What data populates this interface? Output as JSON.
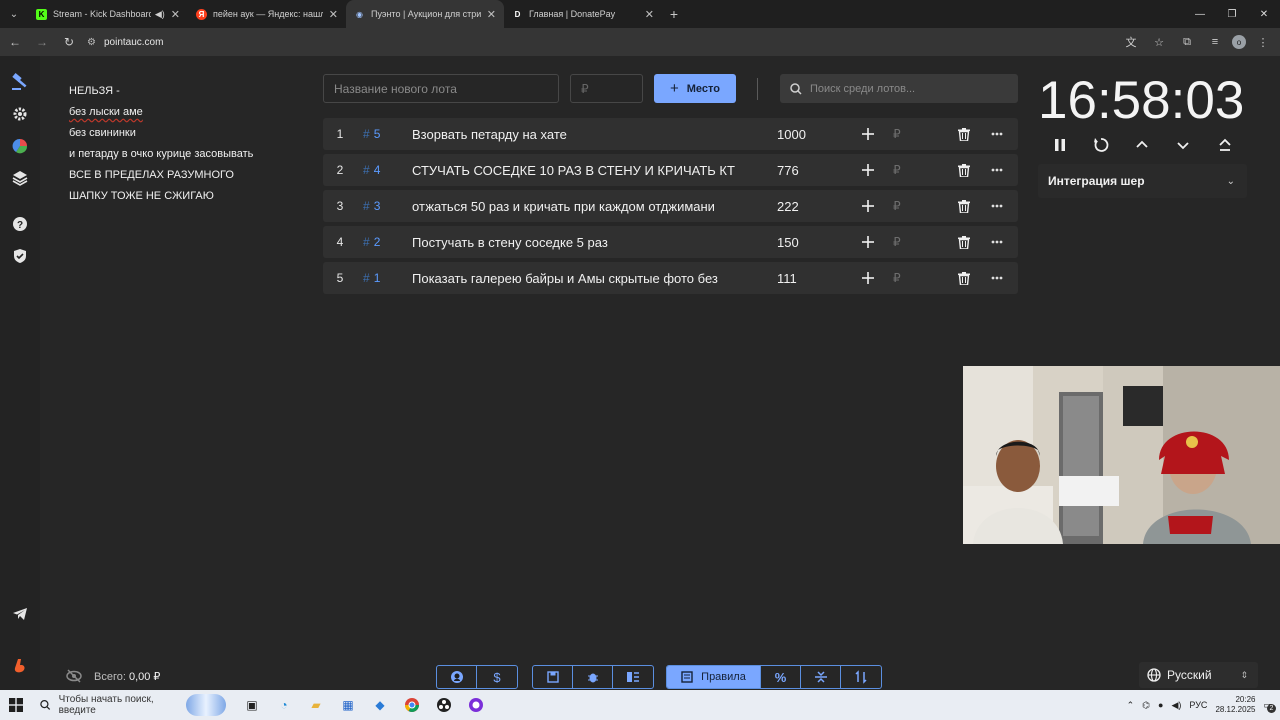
{
  "browser": {
    "tabs": [
      {
        "title": "Stream - Kick Dashboard",
        "favicon": "K",
        "favicon_color": "#53fc18",
        "has_audio": true
      },
      {
        "title": "пейен аук — Яндекс: нашлось",
        "favicon": "Я",
        "favicon_color": "#fc3f1d"
      },
      {
        "title": "Пуэнто | Аукцион для стримеров",
        "favicon": "◉",
        "favicon_color": "#a0c4ff"
      },
      {
        "title": "Главная | DonatePay",
        "favicon": "D",
        "favicon_color": "#2b2b2b"
      }
    ],
    "url": "pointauc.com",
    "profile_initial": "o"
  },
  "rules": {
    "lines": [
      "НЕЛЬЗЯ -",
      "без лыски аме",
      "без свининки",
      "и петарду в очко курице засовывать",
      "ВСЕ В ПРЕДЕЛАХ РАЗУМНОГО",
      "ШАПКУ ТОЖЕ НЕ СЖИГАЮ"
    ]
  },
  "controls": {
    "new_lot_placeholder": "Название нового лота",
    "price_placeholder": "₽",
    "place_button": "Место",
    "search_placeholder": "Поиск среди лотов..."
  },
  "lots": [
    {
      "rank": "1",
      "id": "5",
      "name": "Взорвать петарду на хате",
      "amount": "1000"
    },
    {
      "rank": "2",
      "id": "4",
      "name": "СТУЧАТЬ СОСЕДКЕ 10 РАЗ В СТЕНУ И КРИЧАТЬ КТ",
      "amount": "776"
    },
    {
      "rank": "3",
      "id": "3",
      "name": "отжаться 50 раз и кричать при каждом отджимани",
      "amount": "222"
    },
    {
      "rank": "4",
      "id": "2",
      "name": "Постучать в стену соседке 5 раз",
      "amount": "150"
    },
    {
      "rank": "5",
      "id": "1",
      "name": "Показать галерею байры и Амы скрытые фото без",
      "amount": "111"
    }
  ],
  "currency_symbol": "₽",
  "timer": {
    "value": "16:58:03"
  },
  "integration": {
    "label": "Интеграция шер"
  },
  "total": {
    "label": "Всего:",
    "value": "0,00 ₽"
  },
  "bottom_bar": {
    "rules_label": "Правила"
  },
  "language": {
    "label": "Русский"
  },
  "taskbar": {
    "search_placeholder": "Чтобы начать поиск, введите",
    "keyboard_layout": "РУС",
    "time": "20:26",
    "date": "28.12.2025",
    "notifications": "2"
  },
  "colors": {
    "accent": "#7aa7ff",
    "background": "#262626",
    "row": "#303030"
  }
}
